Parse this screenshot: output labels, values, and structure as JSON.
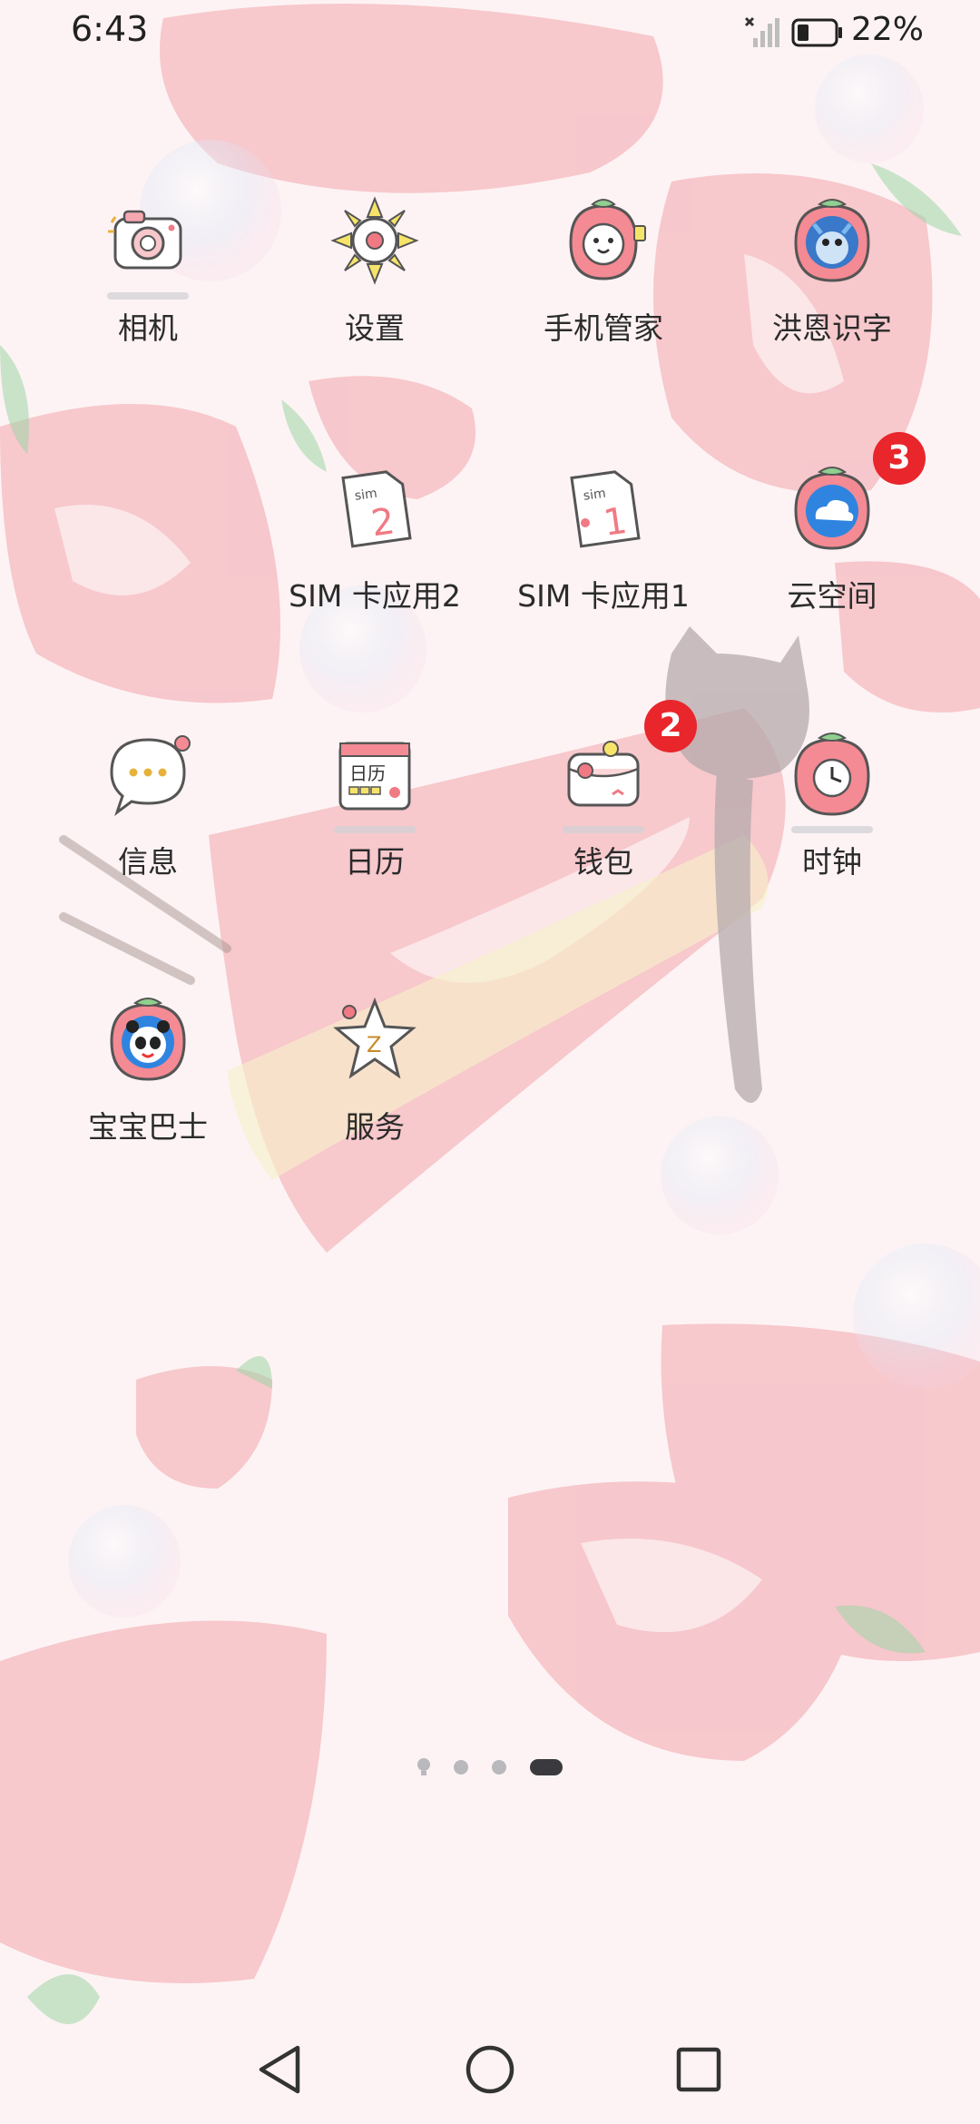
{
  "status_bar": {
    "time": "6:43",
    "battery": "22%",
    "signal_icon": "no-signal-icon",
    "battery_icon": "battery-low-icon"
  },
  "apps": [
    {
      "label": "相机",
      "icon": "camera-icon"
    },
    {
      "label": "设置",
      "icon": "settings-sun-icon"
    },
    {
      "label": "手机管家",
      "icon": "phone-manager-icon"
    },
    {
      "label": "洪恩识字",
      "icon": "hongen-literacy-icon"
    },
    {
      "label": "SIM 卡应用2",
      "icon": "sim2-icon"
    },
    {
      "label": "SIM 卡应用1",
      "icon": "sim1-icon"
    },
    {
      "label": "云空间",
      "icon": "cloud-icon",
      "badge": "3"
    },
    {
      "label": "信息",
      "icon": "message-bubble-icon"
    },
    {
      "label": "日历",
      "icon": "calendar-icon",
      "icon_text": "日历"
    },
    {
      "label": "钱包",
      "icon": "wallet-icon",
      "badge": "2"
    },
    {
      "label": "时钟",
      "icon": "clock-icon"
    },
    {
      "label": "宝宝巴士",
      "icon": "babybus-panda-icon"
    },
    {
      "label": "服务",
      "icon": "service-star-icon",
      "icon_text": "Z"
    }
  ],
  "page_indicator": {
    "pages": 4,
    "active": 4
  },
  "nav": {
    "back_icon": "back-triangle-icon",
    "home_icon": "home-circle-icon",
    "recents_icon": "recents-square-icon"
  },
  "colors": {
    "background": "#fdf2f3",
    "badge": "#e8262b",
    "strawberry": "#f07a84"
  }
}
